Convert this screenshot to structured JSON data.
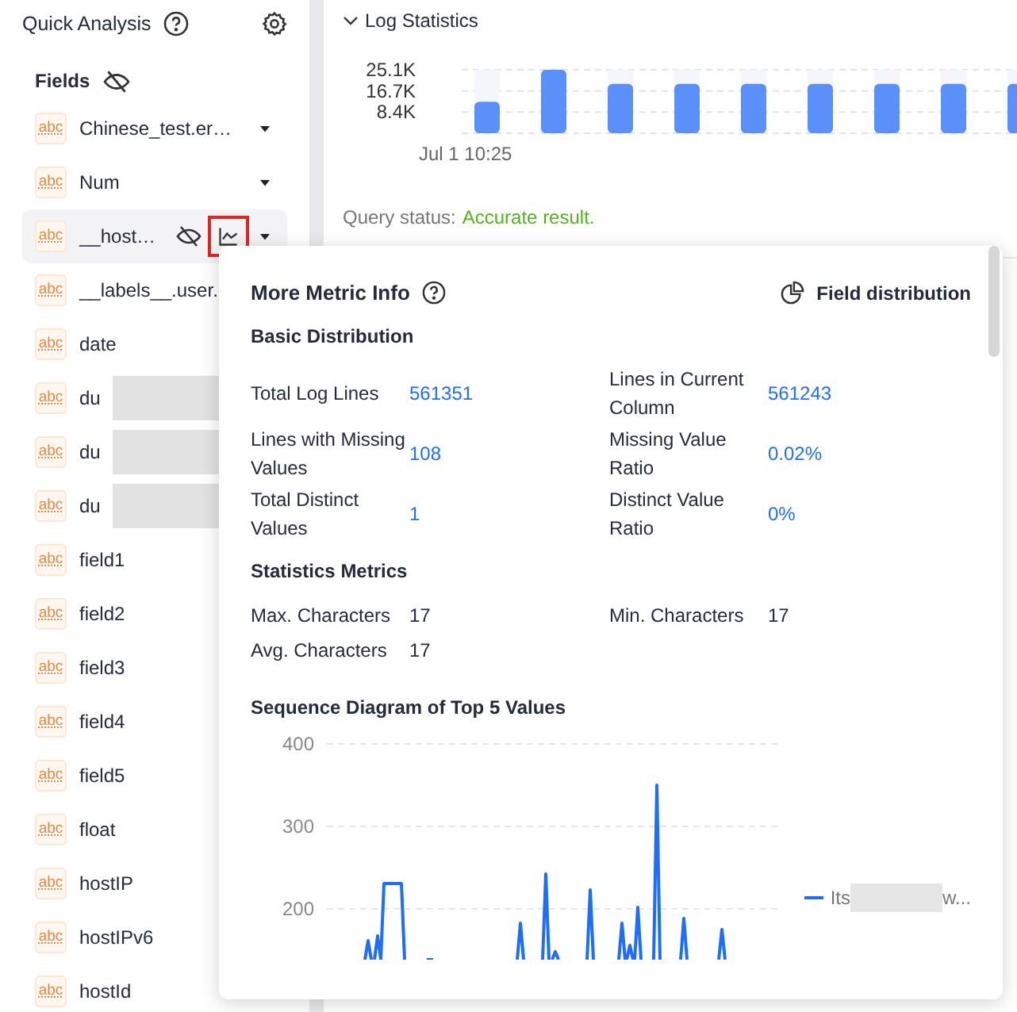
{
  "sidebar": {
    "title": "Quick Analysis",
    "fields_label": "Fields",
    "fields": [
      {
        "type": "abc",
        "name": "Chinese_test.er…",
        "has_menu": true,
        "selected": false,
        "redacted": false
      },
      {
        "type": "abc",
        "name": "Num",
        "has_menu": true,
        "selected": false,
        "redacted": false
      },
      {
        "type": "abc",
        "name": "__host…",
        "has_menu": true,
        "selected": true,
        "redacted": false
      },
      {
        "type": "abc",
        "name": "__labels__.user.",
        "has_menu": false,
        "selected": false,
        "redacted": false
      },
      {
        "type": "abc",
        "name": "date",
        "has_menu": false,
        "selected": false,
        "redacted": false
      },
      {
        "type": "abc",
        "name": "du",
        "has_menu": false,
        "selected": false,
        "redacted": true
      },
      {
        "type": "abc",
        "name": "du",
        "has_menu": false,
        "selected": false,
        "redacted": true
      },
      {
        "type": "abc",
        "name": "du",
        "has_menu": false,
        "selected": false,
        "redacted": true
      },
      {
        "type": "abc",
        "name": "field1",
        "has_menu": false,
        "selected": false,
        "redacted": false
      },
      {
        "type": "abc",
        "name": "field2",
        "has_menu": false,
        "selected": false,
        "redacted": false
      },
      {
        "type": "abc",
        "name": "field3",
        "has_menu": false,
        "selected": false,
        "redacted": false
      },
      {
        "type": "abc",
        "name": "field4",
        "has_menu": false,
        "selected": false,
        "redacted": false
      },
      {
        "type": "abc",
        "name": "field5",
        "has_menu": false,
        "selected": false,
        "redacted": false
      },
      {
        "type": "abc",
        "name": "float",
        "has_menu": false,
        "selected": false,
        "redacted": false
      },
      {
        "type": "abc",
        "name": "hostIP",
        "has_menu": false,
        "selected": false,
        "redacted": false
      },
      {
        "type": "abc",
        "name": "hostIPv6",
        "has_menu": false,
        "selected": false,
        "redacted": false
      },
      {
        "type": "abc",
        "name": "hostId",
        "has_menu": false,
        "selected": false,
        "redacted": false
      }
    ]
  },
  "log_statistics": {
    "title": "Log Statistics",
    "expanded": true,
    "chart_data": {
      "type": "bar",
      "values": [
        12500,
        25100,
        19500,
        19500,
        19500,
        19500,
        19500,
        19500,
        19500
      ],
      "ylim": [
        0,
        25100
      ],
      "yticks": [
        {
          "value": 8400,
          "label": "8.4K"
        },
        {
          "value": 16700,
          "label": "16.7K"
        },
        {
          "value": 25100,
          "label": "25.1K"
        }
      ]
    },
    "time_label": "Jul 1 10:25",
    "query_status_label": "Query status:",
    "query_status": "Accurate result."
  },
  "popover": {
    "title": "More Metric Info",
    "action": "Field distribution",
    "sections": [
      {
        "title": "Basic Distribution",
        "metrics": [
          {
            "label": "Total Log Lines",
            "value": "561351",
            "link": true
          },
          {
            "label": "Lines with Missing Values",
            "value": "108",
            "link": true
          },
          {
            "label": "Total Distinct Values",
            "value": "1",
            "link": true
          },
          {
            "label": "Lines in Current Column",
            "value": "561243",
            "link": true
          },
          {
            "label": "Missing Value Ratio",
            "value": "0.02%",
            "link": true
          },
          {
            "label": "Distinct Value Ratio",
            "value": "0%",
            "link": true
          }
        ]
      },
      {
        "title": "Statistics Metrics",
        "metrics": [
          {
            "label": "Max. Characters",
            "value": "17",
            "link": false
          },
          {
            "label": "Avg. Characters",
            "value": "17",
            "link": false
          },
          {
            "label": "Min. Characters",
            "value": "17",
            "link": false
          }
        ]
      }
    ],
    "sequence": {
      "title": "Sequence Diagram of Top 5 Values",
      "y_axis_labels": [
        "400",
        "300",
        "200"
      ],
      "legend_prefix": "Its",
      "legend_suffix": "w..."
    }
  }
}
